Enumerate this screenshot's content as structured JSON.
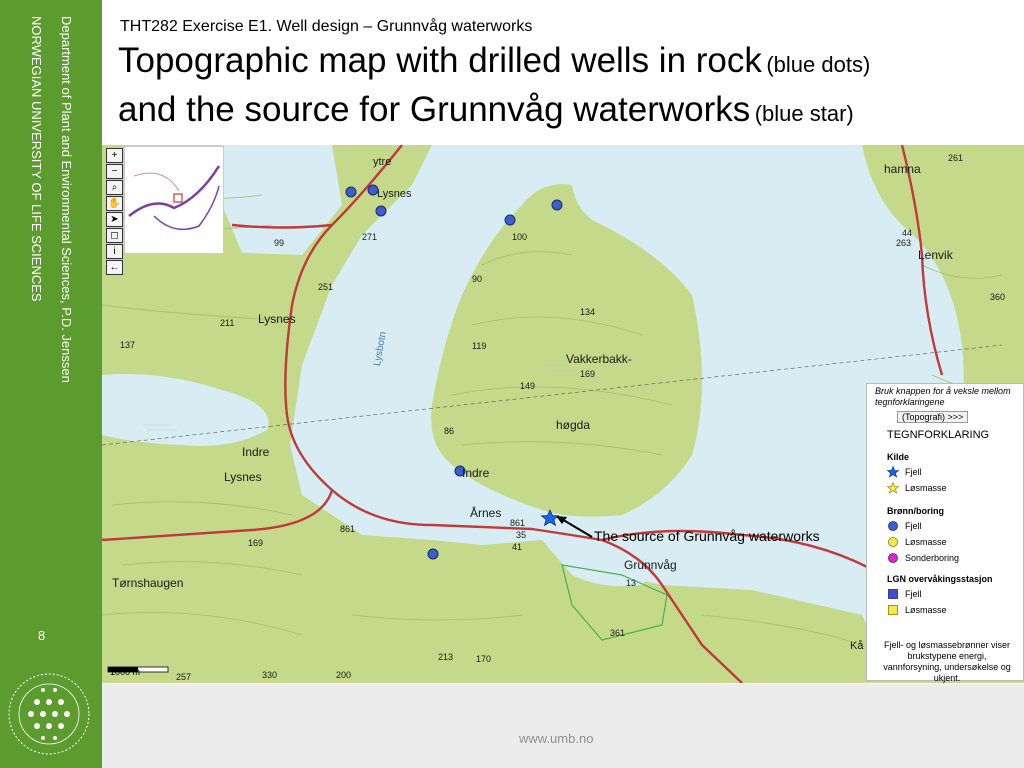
{
  "sidebar": {
    "department": "Department of Plant and Environmental Sciences, P.D. Jenssen",
    "university": "NORWEGIAN UNIVERSITY OF LIFE SCIENCES",
    "slide_number": "8"
  },
  "header": {
    "exercise": "THT282 Exercise E1. Well design – Grunnvåg waterworks",
    "title_line1": "Topographic map with drilled wells in rock",
    "title_line1_small": "(blue dots)",
    "title_line2": "and the source for Grunnvåg waterworks",
    "title_line2_small": "(blue star)"
  },
  "map": {
    "labels": {
      "ytre": "ytre",
      "lysnes_top": "Lysnes",
      "hamna": "hamna",
      "lenvik": "Lenvik",
      "lysnes_mid": "Lysnes",
      "vakkerbakk": "Vakkerbakk-",
      "hogda": "høgda",
      "indre_lysnes_1": "Indre",
      "indre_lysnes_2": "Lysnes",
      "indre": "Indre",
      "arnes": "Årnes",
      "grunnvag": "Grunnvåg",
      "tornshaugen": "Tørnshaugen",
      "lysbotn": "Lysbotn",
      "ka": "Kå"
    },
    "elevations": [
      "261",
      "271",
      "99",
      "100",
      "90",
      "251",
      "211",
      "137",
      "134",
      "119",
      "149",
      "169",
      "86",
      "861",
      "861",
      "35",
      "41",
      "13",
      "361",
      "213",
      "170",
      "330",
      "200",
      "257",
      "169",
      "360",
      "263",
      "44"
    ],
    "scale_label": "1000 m",
    "annotation": "The source of Grunnvåg waterworks",
    "colors": {
      "land": "#c4d98a",
      "water": "#d7edf3",
      "road": "#c0393b",
      "well_dot": "#3d5fcc",
      "star": "#1f63e0"
    }
  },
  "legend": {
    "note": "Bruk knappen for å veksle mellom tegnforklaringene",
    "button": "(Topografi) >>>",
    "heading": "TEGNFORKLARING",
    "source_title": "Kilde",
    "source_items": [
      "Fjell",
      "Løsmasse"
    ],
    "well_title": "Brønn/boring",
    "well_items": [
      "Fjell",
      "Løsmasse",
      "Sonderboring"
    ],
    "lgn_title": "LGN overvåkingsstasjon",
    "lgn_items": [
      "Fjell",
      "Løsmasse"
    ],
    "footer": "Fjell- og løsmassebrønner viser brukstypene energi, vannforsyning, undersøkelse og ukjent."
  },
  "toolbar": {
    "tools": [
      "zoom-in-icon",
      "zoom-out-icon",
      "pan-hand-icon",
      "info-icon",
      "back-icon"
    ]
  },
  "footer": {
    "url": "www.umb.no"
  }
}
